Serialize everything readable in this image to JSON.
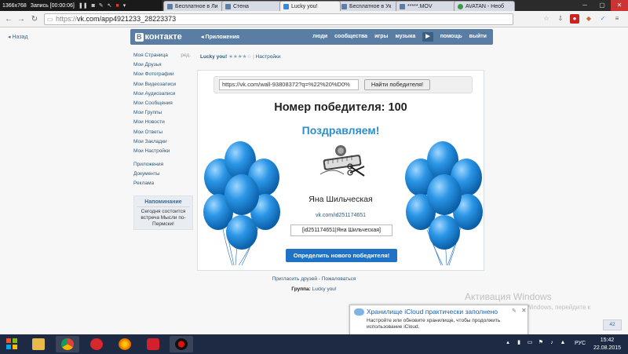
{
  "recorder": {
    "resolution": "1366x768",
    "status": "Запись [00:00:06]"
  },
  "browser": {
    "tabs": [
      {
        "label": "Бесплатное в Ли",
        "active": false
      },
      {
        "label": "Стена",
        "active": false
      },
      {
        "label": "Lucky you!",
        "active": true
      },
      {
        "label": "Бесплатное в Ук",
        "active": false
      },
      {
        "label": "*****.MOV",
        "active": false
      },
      {
        "label": "AVATAN - Необ",
        "active": false
      }
    ],
    "url_prefix": "https://",
    "url": "vk.com/app4921233_28223373",
    "back_label": "Назад"
  },
  "vk": {
    "logo_badge": "В",
    "logo_text": "контакте",
    "apps_label": "Приложения",
    "nav": [
      "люди",
      "сообщества",
      "игры",
      "музыка",
      "помощь",
      "выйти"
    ],
    "nav_play": "▶",
    "sidebar": {
      "edit_label": "ред.",
      "main": [
        "Моя Страница",
        "Мои Друзья",
        "Мои Фотографии",
        "Мои Видеозаписи",
        "Мои Аудиозаписи",
        "Мои Сообщения",
        "Мои Группы",
        "Мои Новости",
        "Мои Ответы",
        "Мои Закладки",
        "Мои Настройки"
      ],
      "extra": [
        "Приложения",
        "Документы",
        "Реклама"
      ],
      "reminder_title": "Напоминание",
      "reminder_body": "Сегодня состоится встреча Мысли по-Пермски!"
    },
    "app": {
      "name": "Lucky you!",
      "rating_stars": "★★★★☆",
      "sep": "|",
      "settings": "Настройки"
    },
    "footer": {
      "invite": "Пригласить друзей",
      "dash": " - ",
      "report": "Пожаловаться",
      "group_label": "Группа:",
      "group_name": "Lucky you!"
    },
    "msg_count": "42"
  },
  "lucky": {
    "post_url": "https://vk.com/wall-93808372?q=%22%20%D0%",
    "find_button": "Найти победителя!",
    "winner_number_text": "Номер победителя: 100",
    "congrats": "Поздравляем!",
    "winner_name": "Яна Шильческая",
    "winner_link": "vk.com/id251174651",
    "winner_code": "[id251174651|Яна Шильческая]",
    "new_winner_button": "Определить нового победителя!"
  },
  "windows": {
    "activation_title": "Активация Windows",
    "activation_text": "Чтобы активировать Windows, перейдите к",
    "icloud_title": "Хранилище iCloud практически заполнено",
    "icloud_msg": "Настройте или обновите хранилище, чтобы продолжить использование iCloud.",
    "language": "РУС",
    "time": "15:42",
    "date": "22.08.2015"
  },
  "colors": {
    "vk_blue": "#597da3",
    "link": "#2b587a",
    "congrats": "#2d8ec8",
    "button": "#2072c6",
    "balloon": "#2b96e6"
  }
}
